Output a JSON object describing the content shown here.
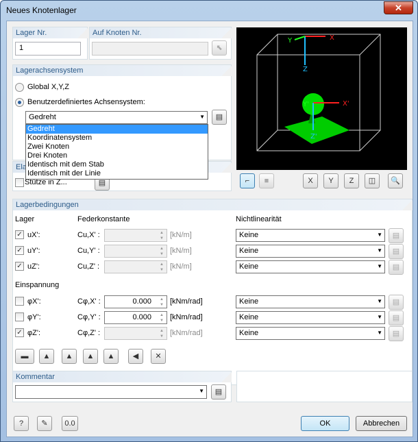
{
  "window": {
    "title": "Neues Knotenlager",
    "close_glyph": "✕"
  },
  "lager_nr": {
    "label": "Lager Nr.",
    "value": "1"
  },
  "auf_knoten": {
    "label": "Auf Knoten Nr.",
    "value": ""
  },
  "achsensystem": {
    "header": "Lagerachsensystem",
    "global_label": "Global X,Y,Z",
    "custom_label": "Benutzerdefiniertes Achsensystem:",
    "selected": "Gedreht",
    "options": [
      "Gedreht",
      "Koordinatensystem",
      "Zwei Knoten",
      "Drei Knoten",
      "Identisch mit dem Stab",
      "Identisch mit der Linie"
    ]
  },
  "elastic": {
    "header": "Elas",
    "stuetze_label": "Stütze in Z..."
  },
  "view": {
    "axes": {
      "x": "X'",
      "y": "Y'",
      "z": "Z'",
      "gx": "X",
      "gy": "Y",
      "gz": "Z"
    }
  },
  "bedingungen": {
    "header": "Lagerbedingungen",
    "col_lager": "Lager",
    "col_feder": "Federkonstante",
    "col_nl": "Nichtlinearität",
    "rows": [
      {
        "cb_label": "uX':",
        "feder_label": "Cu,X' :",
        "value": "",
        "unit": "[kN/m]",
        "nl": "Keine",
        "checked": "✓"
      },
      {
        "cb_label": "uY':",
        "feder_label": "Cu,Y' :",
        "value": "",
        "unit": "[kN/m]",
        "nl": "Keine",
        "checked": "✓"
      },
      {
        "cb_label": "uZ':",
        "feder_label": "Cu,Z' :",
        "value": "",
        "unit": "[kN/m]",
        "nl": "Keine",
        "checked": "✓"
      }
    ],
    "einspannung": "Einspannung",
    "rows2": [
      {
        "cb_label": "φX':",
        "feder_label": "Cφ,X' :",
        "value": "0.000",
        "unit": "[kNm/rad]",
        "nl": "Keine",
        "checked": ""
      },
      {
        "cb_label": "φY':",
        "feder_label": "Cφ,Y' :",
        "value": "0.000",
        "unit": "[kNm/rad]",
        "nl": "Keine",
        "checked": ""
      },
      {
        "cb_label": "φZ':",
        "feder_label": "Cφ,Z' :",
        "value": "",
        "unit": "[kNm/rad]",
        "nl": "Keine",
        "checked": "✓"
      }
    ]
  },
  "kommentar": {
    "header": "Kommentar",
    "value": ""
  },
  "buttons": {
    "ok": "OK",
    "cancel": "Abbrechen"
  }
}
